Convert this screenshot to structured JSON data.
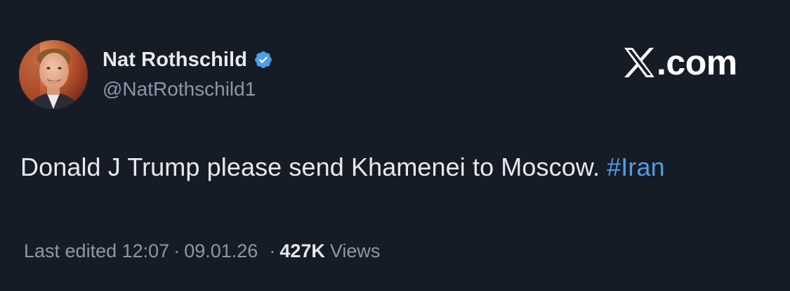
{
  "author": {
    "display_name": "Nat Rothschild",
    "handle": "@NatRothschild1",
    "verified_icon": "verified-badge-icon",
    "verified_color": "#4a9eea"
  },
  "brand": {
    "logo_icon": "x-logo-icon",
    "text": ".com"
  },
  "tweet": {
    "text": "Donald J Trump please send Khamenei to Moscow. ",
    "hashtag": "#Iran",
    "hashtag_color": "#4a9eea"
  },
  "meta": {
    "edited_label": "Last edited",
    "time": "12:07",
    "separator": "·",
    "date": "09.01.26",
    "views_count": "427K",
    "views_label": "Views"
  },
  "colors": {
    "background": "#161c26",
    "text_primary": "#e7e9ea",
    "text_secondary": "#8b98a5",
    "accent": "#4a9eea"
  }
}
